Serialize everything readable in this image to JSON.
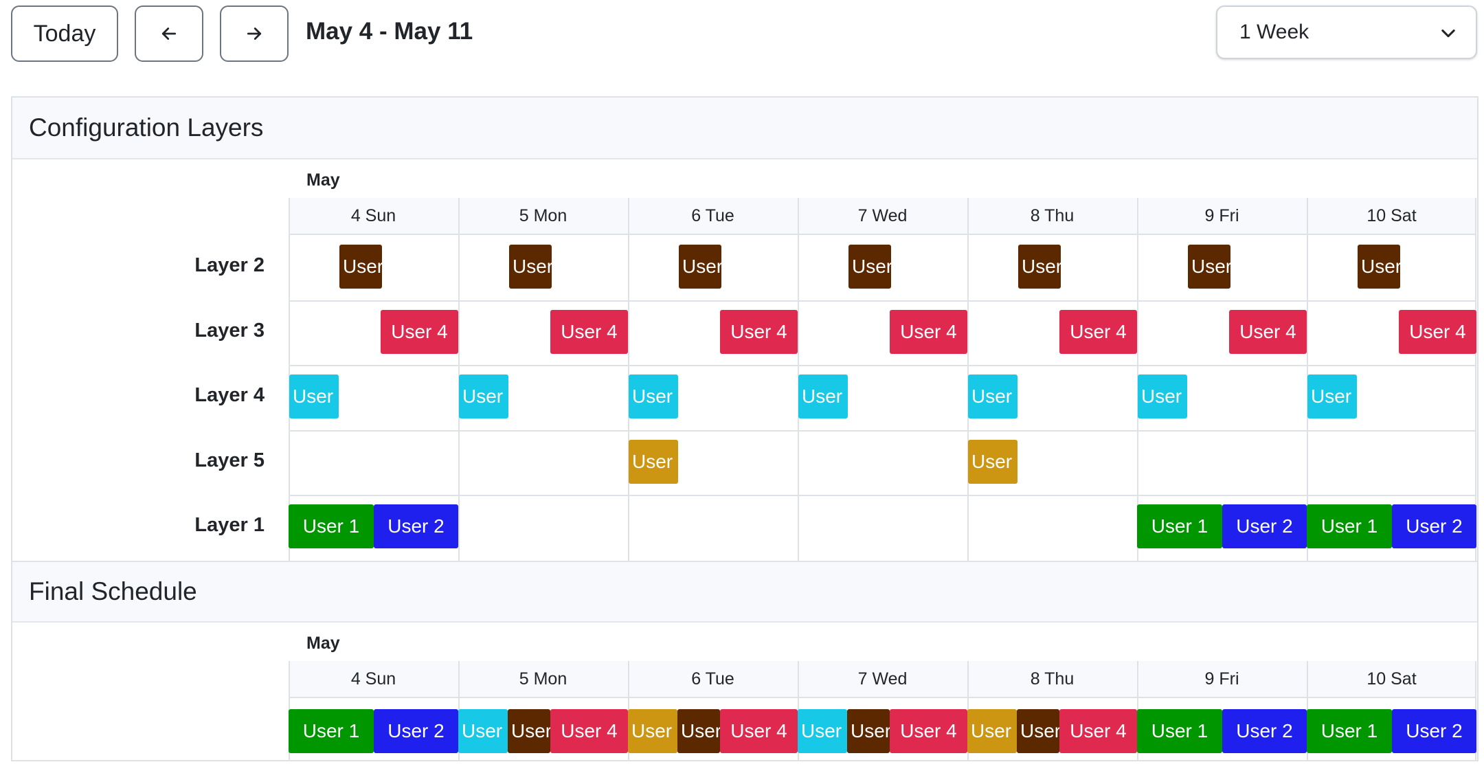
{
  "toolbar": {
    "today_label": "Today",
    "prev_icon": "arrow-left-icon",
    "next_icon": "arrow-right-icon",
    "date_range": "May 4 - May 11",
    "view_select": {
      "selected": "1 Week",
      "icon": "chevron-down-icon"
    }
  },
  "sections": {
    "layers_title": "Configuration Layers",
    "final_title": "Final Schedule"
  },
  "calendar": {
    "month": "May",
    "days": [
      "4 Sun",
      "5 Mon",
      "6 Tue",
      "7 Wed",
      "8 Thu",
      "9 Fri",
      "10 Sat"
    ]
  },
  "layers": [
    {
      "name": "Layer 2",
      "events": [
        {
          "label": "User",
          "color": "#5c2800"
        },
        {
          "label": "User",
          "color": "#5c2800"
        },
        {
          "label": "User",
          "color": "#5c2800"
        },
        {
          "label": "User",
          "color": "#5c2800"
        },
        {
          "label": "User",
          "color": "#5c2800"
        },
        {
          "label": "User",
          "color": "#5c2800"
        },
        {
          "label": "User",
          "color": "#5c2800"
        }
      ]
    },
    {
      "name": "Layer 3",
      "events": [
        {
          "label": "User 4",
          "color": "#e0294f"
        },
        {
          "label": "User 4",
          "color": "#e0294f"
        },
        {
          "label": "User 4",
          "color": "#e0294f"
        },
        {
          "label": "User 4",
          "color": "#e0294f"
        },
        {
          "label": "User 4",
          "color": "#e0294f"
        },
        {
          "label": "User 4",
          "color": "#e0294f"
        },
        {
          "label": "User 4",
          "color": "#e0294f"
        }
      ]
    },
    {
      "name": "Layer 4",
      "events": [
        {
          "label": "User",
          "color": "#17c9e6"
        },
        {
          "label": "User",
          "color": "#17c9e6"
        },
        {
          "label": "User",
          "color": "#17c9e6"
        },
        {
          "label": "User",
          "color": "#17c9e6"
        },
        {
          "label": "User",
          "color": "#17c9e6"
        },
        {
          "label": "User",
          "color": "#17c9e6"
        },
        {
          "label": "User",
          "color": "#17c9e6"
        }
      ]
    },
    {
      "name": "Layer 5",
      "events": [
        {
          "label": "User",
          "color": "#cc9512"
        },
        {
          "label": "User",
          "color": "#cc9512"
        }
      ]
    },
    {
      "name": "Layer 1",
      "events": [
        {
          "label": "User 1",
          "color": "#009600"
        },
        {
          "label": "User 2",
          "color": "#2020ee"
        },
        {
          "label": "User 1",
          "color": "#009600"
        },
        {
          "label": "User 2",
          "color": "#2020ee"
        },
        {
          "label": "User 1",
          "color": "#009600"
        },
        {
          "label": "User 2",
          "color": "#2020ee"
        }
      ]
    }
  ],
  "final_schedule": [
    {
      "label": "User 1",
      "color": "#009600"
    },
    {
      "label": "User 2",
      "color": "#2020ee"
    },
    {
      "label": "User",
      "color": "#17c9e6"
    },
    {
      "label": "User",
      "color": "#5c2800"
    },
    {
      "label": "User 4",
      "color": "#e0294f"
    },
    {
      "label": "User",
      "color": "#cc9512"
    },
    {
      "label": "User",
      "color": "#5c2800"
    },
    {
      "label": "User 4",
      "color": "#e0294f"
    },
    {
      "label": "User",
      "color": "#17c9e6"
    },
    {
      "label": "User",
      "color": "#5c2800"
    },
    {
      "label": "User 4",
      "color": "#e0294f"
    },
    {
      "label": "User",
      "color": "#cc9512"
    },
    {
      "label": "User",
      "color": "#5c2800"
    },
    {
      "label": "User 4",
      "color": "#e0294f"
    },
    {
      "label": "User 1",
      "color": "#009600"
    },
    {
      "label": "User 2",
      "color": "#2020ee"
    },
    {
      "label": "User 1",
      "color": "#009600"
    },
    {
      "label": "User 2",
      "color": "#2020ee"
    }
  ]
}
